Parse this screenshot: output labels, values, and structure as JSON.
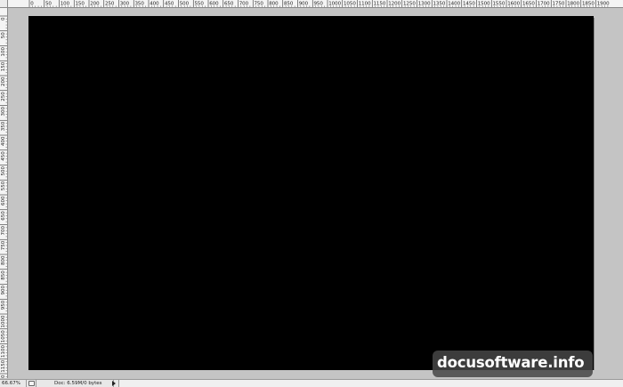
{
  "rulers": {
    "top_labels": [
      "0",
      "50",
      "100",
      "150",
      "200",
      "250",
      "300",
      "350",
      "400",
      "450",
      "500",
      "550",
      "600",
      "650",
      "700",
      "750",
      "800",
      "850",
      "900",
      "950",
      "1000",
      "1050",
      "1100",
      "1150",
      "1200",
      "1250",
      "1300",
      "1350",
      "1400",
      "1450",
      "1500",
      "1550",
      "1600",
      "1650",
      "1700",
      "1750",
      "1800",
      "1850",
      "1900"
    ],
    "left_labels": [
      "0",
      "50",
      "100",
      "150",
      "200",
      "250",
      "300",
      "350",
      "400",
      "450",
      "500",
      "550",
      "600",
      "650",
      "700",
      "750",
      "800",
      "850",
      "900",
      "950",
      "1000",
      "1050",
      "1100",
      "1150",
      "1200"
    ]
  },
  "canvas": {
    "fill_color": "#000000"
  },
  "watermark": {
    "text": "docusoftware.info"
  },
  "statusbar": {
    "zoom": "66.67%",
    "doc_info": "Doc: 6.59M/0 bytes"
  }
}
